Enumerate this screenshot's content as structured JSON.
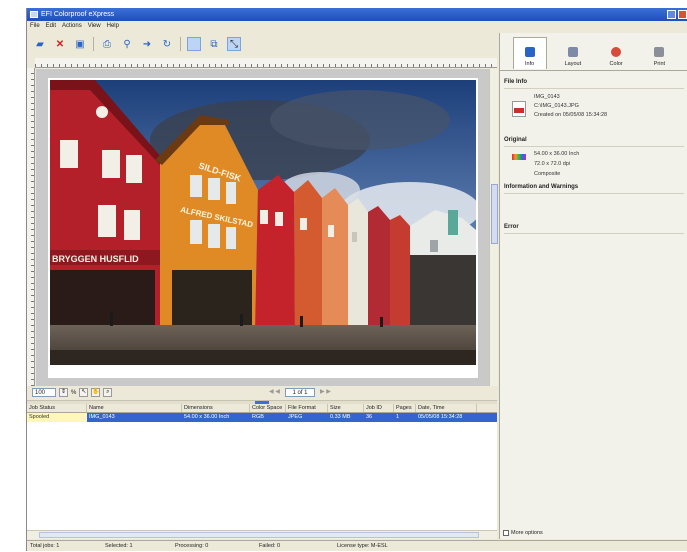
{
  "window": {
    "title": "EFI Colorproof eXpress"
  },
  "menu": [
    "File",
    "Edit",
    "Actions",
    "View",
    "Help"
  ],
  "toolbar": {
    "icons": [
      "folder-icon",
      "delete-icon",
      "save-icon",
      "print-icon",
      "pin-icon",
      "forward-icon",
      "refresh-icon",
      "select-icon",
      "compare-icon",
      "transform-icon"
    ]
  },
  "preview": {
    "zoom": "100",
    "zoom_unit": "%",
    "page_indicator": "1 of 1",
    "prev": "◀ ◀",
    "next": "▶ ▶"
  },
  "jobs": {
    "columns": [
      "Job Status",
      "Name",
      "Dimensions",
      "Color Space",
      "File Format",
      "Size",
      "Job ID",
      "Pages",
      "Date, Time"
    ],
    "rows": [
      {
        "status": "Spooled",
        "name": "IMG_0143",
        "dimensions": "54.00 x 36.00 Inch",
        "color_space": "RGB",
        "file_format": "JPEG",
        "size": "0.33 MB",
        "job_id": "36",
        "pages": "1",
        "date": "05/05/08 15:34:28"
      }
    ]
  },
  "statusbar": {
    "total": "Total jobs: 1",
    "selected": "Selected: 1",
    "processing": "Processing: 0",
    "failed": "Failed: 0",
    "license": "License type: M-ESL"
  },
  "rpanel": {
    "tabs": [
      {
        "label": "Info",
        "icon": "info-icon",
        "color": "#2a64c7"
      },
      {
        "label": "Layout",
        "icon": "layout-icon",
        "color": "#7f8aa8"
      },
      {
        "label": "Color",
        "icon": "color-icon",
        "color": "#d64b3a"
      },
      {
        "label": "Print",
        "icon": "print-icon",
        "color": "#8a8f9a"
      }
    ],
    "file_info_title": "File Info",
    "file_name": "IMG_0143",
    "file_path": "C:\\IMG_0143.JPG",
    "created": "Created on 05/05/08 15:34:28",
    "original_title": "Original",
    "dimensions": "54.00 x 36.00 Inch",
    "dpi": "72.0 x 72.0 dpi",
    "mode": "Composite",
    "warnings_title": "Information and Warnings",
    "error_title": "Error",
    "more_options": "More options"
  }
}
